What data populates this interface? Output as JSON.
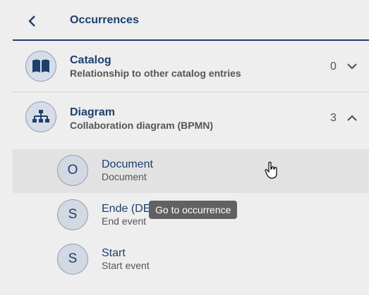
{
  "header": {
    "title": "Occurrences"
  },
  "sections": [
    {
      "title": "Catalog",
      "subtitle": "Relationship to other catalog entries",
      "count": "0",
      "icon": "book-icon",
      "expanded": false
    },
    {
      "title": "Diagram",
      "subtitle": "Collaboration diagram (BPMN)",
      "count": "3",
      "icon": "hierarchy-icon",
      "expanded": true
    }
  ],
  "items": [
    {
      "initial": "O",
      "title": "Document",
      "subtitle": "Document"
    },
    {
      "initial": "S",
      "title": "Ende (DE",
      "subtitle": "End event"
    },
    {
      "initial": "S",
      "title": "Start",
      "subtitle": "Start event"
    }
  ],
  "tooltip": "Go to occurrence",
  "colors": {
    "accent": "#1d3f6e",
    "background": "#eeeeee",
    "highlight": "#e2e2e2"
  }
}
